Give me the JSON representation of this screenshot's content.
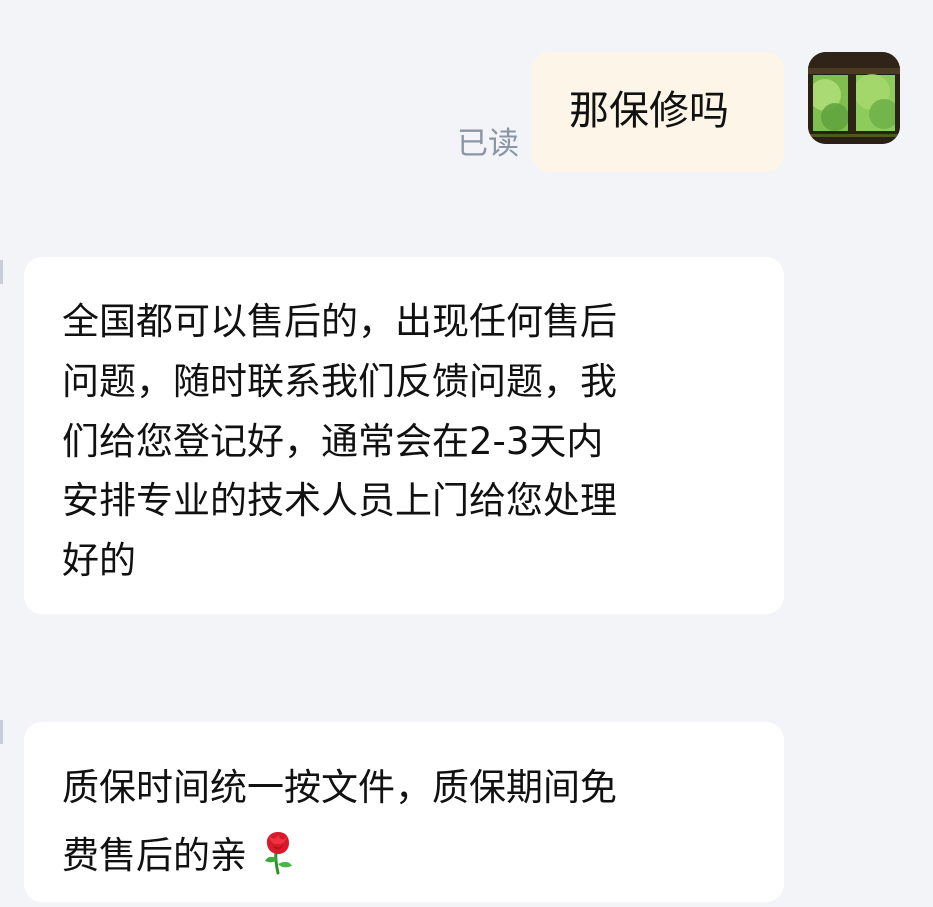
{
  "chat": {
    "outgoing": {
      "text": "那保修吗",
      "status": "已读",
      "avatar": "garden-view-photo"
    },
    "incoming": [
      {
        "sender": "",
        "lines": [
          "全国都可以售后的，出现任何售后",
          "问题，随时联系我们反馈问题，我",
          "们给您登记好，通常会在2-3天内",
          "安排专业的技术人员上门给您处理",
          "好的"
        ]
      },
      {
        "sender": "",
        "lines": [
          "质保时间统一按文件，质保期间免",
          "费售后的亲"
        ],
        "emoji": "rose-emoji"
      }
    ]
  },
  "colors": {
    "background": "#f3f4f7",
    "incoming_bubble": "#ffffff",
    "outgoing_bubble": "#fdf5e7",
    "text": "#111111",
    "read_receipt": "#8b95a6"
  }
}
